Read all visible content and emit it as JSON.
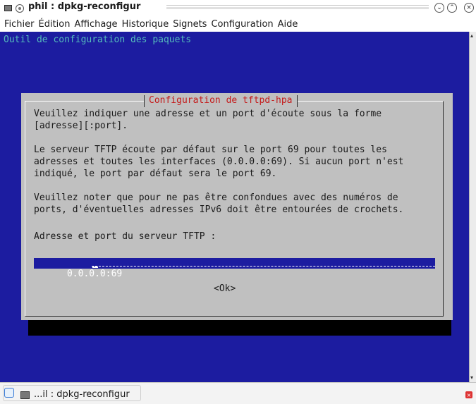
{
  "window": {
    "title": "phil : dpkg-reconfigur",
    "buttons": [
      "minimize-icon",
      "maximize-icon",
      "close-icon"
    ]
  },
  "menubar": {
    "items": [
      "Fichier",
      "Édition",
      "Affichage",
      "Historique",
      "Signets",
      "Configuration",
      "Aide"
    ]
  },
  "terminal": {
    "header": "Outil de configuration des paquets",
    "colors": {
      "background": "#1c1ca0",
      "header_text": "#55bbbb",
      "dialog_bg": "#c0c0c0",
      "dialog_title": "#c41a1a"
    },
    "dialog": {
      "title": "Configuration de tftpd-hpa",
      "lines": [
        "Veuillez indiquer une adresse et un port d'écoute sous la forme",
        "[adresse][:port].",
        "",
        "Le serveur TFTP écoute par défaut sur le port 69 pour toutes les",
        "adresses et toutes les interfaces (0.0.0.0:69). Si aucun port n'est",
        "indiqué, le port par défaut sera le port 69.",
        "",
        "Veuillez noter que pour ne pas être confondues avec des numéros de",
        "ports, d'éventuelles adresses IPv6 doit être entourées de crochets.",
        "",
        "Adresse et port du serveur TFTP :"
      ],
      "input_value": "0.0.0.0:69",
      "ok_label": "<Ok>"
    }
  },
  "taskbar": {
    "task_label": "...il : dpkg-reconfigur"
  }
}
